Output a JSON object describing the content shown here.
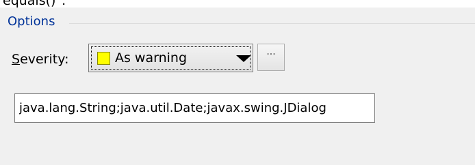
{
  "header_fragment": "equals()\".",
  "options": {
    "group_title": "Options",
    "severity": {
      "label_mnemonic": "S",
      "label_rest": "everity:",
      "selected": "As warning",
      "swatch_color": "#ffff00",
      "more_button": "···"
    },
    "classes_value": "java.lang.String;java.util.Date;javax.swing.JDialog"
  }
}
